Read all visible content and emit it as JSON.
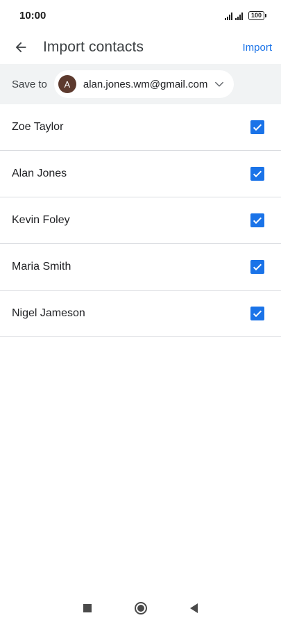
{
  "status_bar": {
    "time": "10:00",
    "battery": "100",
    "icons": [
      "signal-icon",
      "signal-icon",
      "battery-icon"
    ]
  },
  "app_bar": {
    "title": "Import contacts",
    "action_label": "Import",
    "back_icon": "arrow-back-icon",
    "accent_color": "#1a73e8"
  },
  "save_to": {
    "label": "Save to",
    "account": {
      "avatar_letter": "A",
      "avatar_color": "#5d3a2e",
      "email": "alan.jones.wm@gmail.com"
    },
    "dropdown_icon": "chevron-down-icon"
  },
  "contacts": [
    {
      "name": "Zoe Taylor",
      "checked": true
    },
    {
      "name": "Alan Jones",
      "checked": true
    },
    {
      "name": "Kevin Foley",
      "checked": true
    },
    {
      "name": "Maria Smith",
      "checked": true
    },
    {
      "name": "Nigel Jameson",
      "checked": true
    }
  ],
  "nav_bar": {
    "icons": [
      "recents-icon",
      "home-icon",
      "back-icon"
    ]
  }
}
